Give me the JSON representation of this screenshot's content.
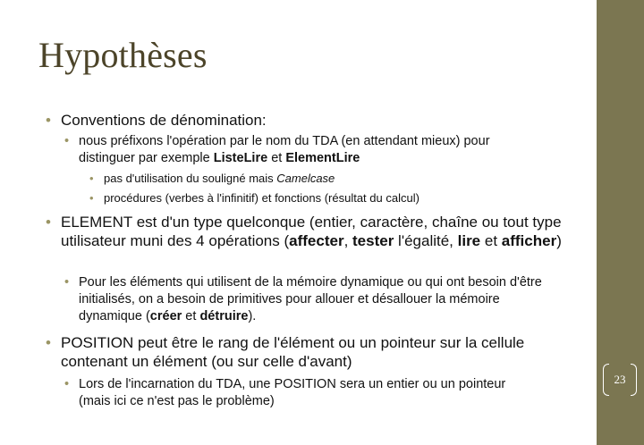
{
  "slide": {
    "title": "Hypothèses",
    "page_number": "23",
    "colors": {
      "title": "#4c4429",
      "sidebar": "#7b7651",
      "bullet": "#9b9565",
      "text": "#111111"
    },
    "bullets": [
      {
        "level": 1,
        "parts": [
          {
            "t": "Conventions de dénomination:"
          }
        ]
      },
      {
        "level": 2,
        "parts": [
          {
            "t": "nous préfixons l'opération par le nom du TDA (en attendant mieux) pour distinguer par exemple "
          },
          {
            "t": "ListeLire",
            "b": true
          },
          {
            "t": " et "
          },
          {
            "t": "ElementLire",
            "b": true
          }
        ]
      },
      {
        "level": 3,
        "parts": [
          {
            "t": "pas d'utilisation du souligné mais "
          },
          {
            "t": "Camelcase",
            "i": true
          }
        ]
      },
      {
        "level": 3,
        "parts": [
          {
            "t": "procédures (verbes à l'infinitif) et fonctions (résultat du calcul)"
          }
        ]
      },
      {
        "level": 1,
        "parts": [
          {
            "t": "ELEMENT est d'un type quelconque (entier, caractère, chaîne ou tout type utilisateur muni des 4 opérations ("
          },
          {
            "t": "affecter",
            "b": true
          },
          {
            "t": ", "
          },
          {
            "t": "tester",
            "b": true
          },
          {
            "t": " l'égalité, "
          },
          {
            "t": "lire",
            "b": true
          },
          {
            "t": " et "
          },
          {
            "t": "afficher",
            "b": true
          },
          {
            "t": ")"
          }
        ]
      },
      {
        "level": 2,
        "parts": [
          {
            "t": "Pour les éléments qui utilisent de la mémoire dynamique ou qui ont besoin d'être initialisés, on a besoin de primitives pour allouer et désallouer la mémoire dynamique ("
          },
          {
            "t": "créer",
            "b": true
          },
          {
            "t": " et "
          },
          {
            "t": "détruire",
            "b": true
          },
          {
            "t": ")."
          }
        ]
      },
      {
        "level": 1,
        "parts": [
          {
            "t": "POSITION peut être le rang de l'élément ou un pointeur sur la cellule contenant un élément (ou sur celle d'avant)"
          }
        ]
      },
      {
        "level": 2,
        "parts": [
          {
            "t": "Lors de l'incarnation du TDA, une POSITION sera un entier ou un pointeur (mais ici ce n'est pas le problème)"
          }
        ]
      }
    ]
  }
}
